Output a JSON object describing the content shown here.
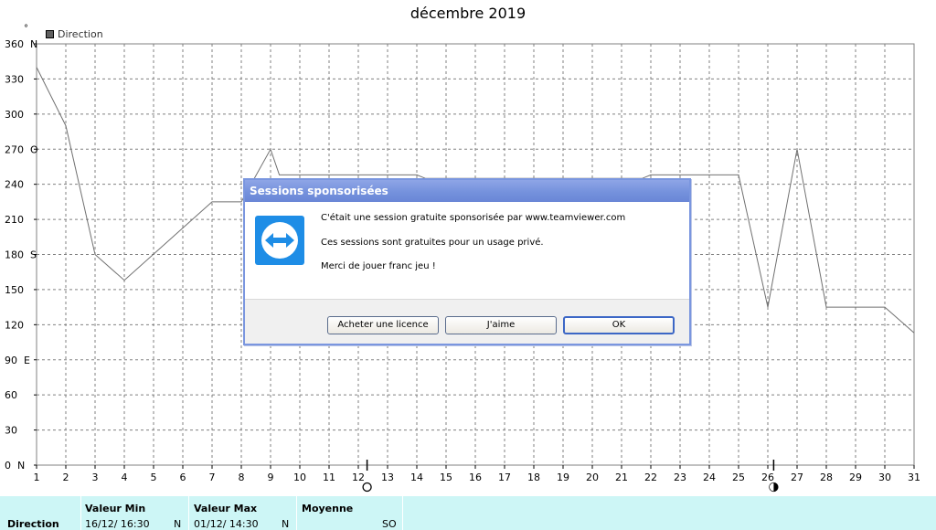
{
  "chart_data": {
    "type": "line",
    "title": "décembre 2019",
    "ylabel": "°",
    "legend": [
      "Direction"
    ],
    "legend_placement": "top-left",
    "grid": true,
    "ylim": [
      0,
      360
    ],
    "xlim": [
      1,
      31
    ],
    "y_ticks": [
      "0  N",
      "30",
      "60",
      "90  E",
      "120",
      "150",
      "180  S",
      "210",
      "240",
      "270  O",
      "300",
      "330",
      "360  N"
    ],
    "x_ticks": [
      "1",
      "2",
      "3",
      "4",
      "5",
      "6",
      "7",
      "8",
      "9",
      "10",
      "11",
      "12",
      "13",
      "14",
      "15",
      "16",
      "17",
      "18",
      "19",
      "20",
      "21",
      "22",
      "23",
      "24",
      "25",
      "26",
      "27",
      "28",
      "29",
      "30",
      "31"
    ],
    "series": [
      {
        "name": "Direction",
        "color": "#707070",
        "x": [
          1,
          2,
          3,
          4,
          7,
          8,
          9,
          9.3,
          12.8,
          13,
          14,
          14.3,
          21.7,
          22,
          25,
          26,
          27,
          28,
          30,
          31
        ],
        "values": [
          340,
          290,
          180,
          158,
          225,
          225,
          270,
          248,
          248,
          248,
          248,
          245,
          245,
          248,
          248,
          135,
          270,
          135,
          135,
          113
        ]
      }
    ],
    "moon_markers": [
      {
        "x": 12.3,
        "phase": "full-moon"
      },
      {
        "x": 26.2,
        "phase": "new-moon"
      }
    ]
  },
  "dialog": {
    "title": "Sessions sponsorisées",
    "icon": "teamviewer-icon",
    "line1": "C'était une session gratuite sponsorisée par www.teamviewer.com",
    "line2": "Ces sessions sont gratuites pour un usage privé.",
    "line3": "Merci de jouer franc jeu !",
    "btn_license": "Acheter une licence",
    "btn_like": "J'aime",
    "btn_ok": "OK"
  },
  "stats": {
    "row_label": "Direction",
    "min_header": "Valeur Min",
    "min_date": "16/12/  16:30",
    "min_value": "N",
    "max_header": "Valeur Max",
    "max_date": "01/12/  14:30",
    "max_value": "N",
    "avg_header": "Moyenne",
    "avg_value": "SO",
    "bg_color": "#cdf6f6"
  }
}
